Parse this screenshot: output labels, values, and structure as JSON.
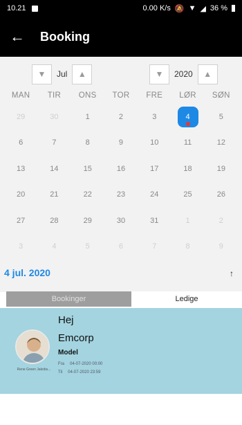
{
  "status_bar": {
    "time": "10.21",
    "network": "0.00 K/s",
    "battery": "36 %"
  },
  "app_bar": {
    "title": "Booking"
  },
  "month_picker": {
    "value": "Jul"
  },
  "year_picker": {
    "value": "2020"
  },
  "weekdays": [
    "MAN",
    "TIR",
    "ONS",
    "TOR",
    "FRE",
    "LØR",
    "SØN"
  ],
  "weeks": [
    [
      {
        "d": "29",
        "m": true
      },
      {
        "d": "30",
        "m": true
      },
      {
        "d": "1"
      },
      {
        "d": "2"
      },
      {
        "d": "3"
      },
      {
        "d": "4",
        "sel": true
      },
      {
        "d": "5"
      }
    ],
    [
      {
        "d": "6"
      },
      {
        "d": "7"
      },
      {
        "d": "8"
      },
      {
        "d": "9"
      },
      {
        "d": "10"
      },
      {
        "d": "11"
      },
      {
        "d": "12"
      }
    ],
    [
      {
        "d": "13"
      },
      {
        "d": "14"
      },
      {
        "d": "15"
      },
      {
        "d": "16"
      },
      {
        "d": "17"
      },
      {
        "d": "18"
      },
      {
        "d": "19"
      }
    ],
    [
      {
        "d": "20"
      },
      {
        "d": "21"
      },
      {
        "d": "22"
      },
      {
        "d": "23"
      },
      {
        "d": "24"
      },
      {
        "d": "25"
      },
      {
        "d": "26"
      }
    ],
    [
      {
        "d": "27"
      },
      {
        "d": "28"
      },
      {
        "d": "29"
      },
      {
        "d": "30"
      },
      {
        "d": "31"
      },
      {
        "d": "1",
        "m": true
      },
      {
        "d": "2",
        "m": true
      }
    ],
    [
      {
        "d": "3",
        "m": true
      },
      {
        "d": "4",
        "m": true
      },
      {
        "d": "5",
        "m": true
      },
      {
        "d": "6",
        "m": true
      },
      {
        "d": "7",
        "m": true
      },
      {
        "d": "8",
        "m": true
      },
      {
        "d": "9",
        "m": true
      }
    ]
  ],
  "selected_date_label": "4 jul. 2020",
  "collapse_icon": "arrow-up-icon",
  "tabs": {
    "bookinger": "Bookinger",
    "ledige": "Ledige"
  },
  "booking": {
    "greeting": "Hej",
    "company": "Emcorp",
    "role": "Model",
    "person_name": "Rene Green Jakobs...",
    "from_label": "Fra",
    "from_value": "04-07-2020 00:00",
    "to_label": "Til",
    "to_value": "04-07-2020 23:59"
  },
  "colors": {
    "accent": "#1e88e5",
    "card_bg": "#a3d4e0",
    "dot": "#e53935"
  }
}
